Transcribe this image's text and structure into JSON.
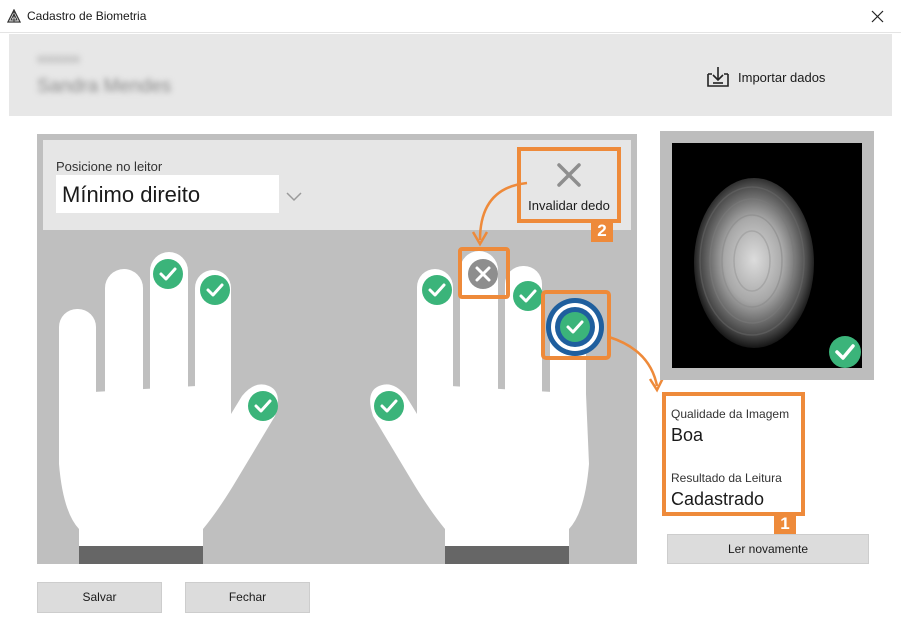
{
  "window": {
    "title": "Cadastro de Biometria",
    "close_icon": "close-icon",
    "app_icon": "biometric-app-icon"
  },
  "header": {
    "user_code": "0000000",
    "user_name": "Sandra Mendes",
    "import_label": "Importar dados",
    "import_icon": "import-download-icon"
  },
  "capture": {
    "position_label": "Posicione no leitor",
    "selected_finger": "Mínimo direito",
    "invalidate_label": "Invalidar dedo",
    "invalidate_icon": "x-mark-icon",
    "invalidate_badge": "2"
  },
  "fingers": {
    "left_hand": [
      {
        "finger": "little",
        "status": "none"
      },
      {
        "finger": "ring",
        "status": "none"
      },
      {
        "finger": "middle",
        "status": "ok"
      },
      {
        "finger": "index",
        "status": "ok"
      },
      {
        "finger": "thumb",
        "status": "ok"
      }
    ],
    "right_hand": [
      {
        "finger": "thumb",
        "status": "ok"
      },
      {
        "finger": "index",
        "status": "ok"
      },
      {
        "finger": "middle",
        "status": "invalid"
      },
      {
        "finger": "ring",
        "status": "ok"
      },
      {
        "finger": "little",
        "status": "selected"
      }
    ]
  },
  "result": {
    "quality_label": "Qualidade da Imagem",
    "quality_value": "Boa",
    "read_label": "Resultado da Leitura",
    "read_value": "Cadastrado",
    "badge": "1",
    "check_icon": "check-circle-icon"
  },
  "buttons": {
    "read_again": "Ler novamente",
    "save": "Salvar",
    "close": "Fechar"
  },
  "colors": {
    "accent_orange": "#ee8a3a",
    "ok_green": "#3bb47a",
    "invalid_gray": "#8e8e8e",
    "selected_blue": "#1f5f9e",
    "hand_area": "#bfbfbf"
  }
}
